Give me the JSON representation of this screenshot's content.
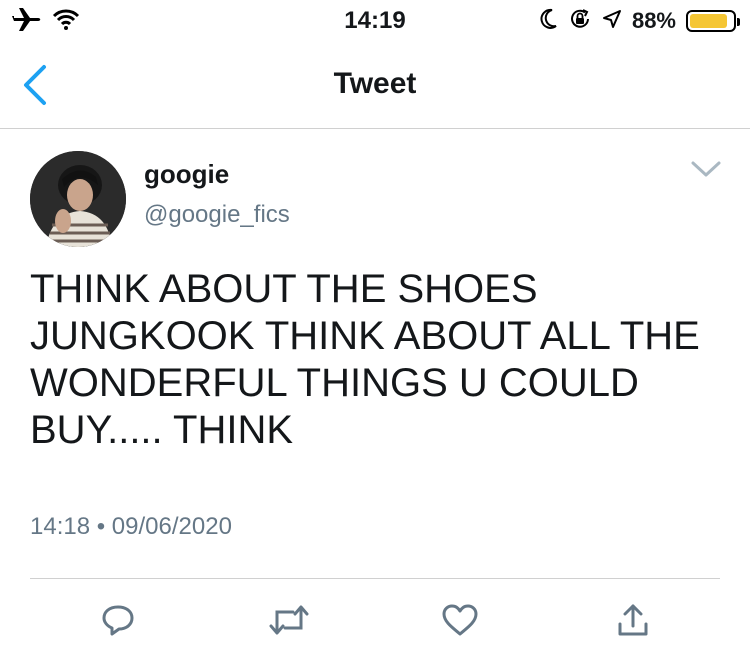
{
  "status_bar": {
    "time": "14:19",
    "battery": "88%",
    "battery_level": 0.88,
    "icons": [
      "airplane-icon",
      "wifi-icon",
      "moon-icon",
      "orientation-lock-icon",
      "location-icon",
      "battery-icon"
    ]
  },
  "nav": {
    "title": "Tweet",
    "back_icon": "chevron-left-icon"
  },
  "tweet": {
    "author_name": "googie",
    "author_handle": "@googie_fics",
    "text": "THINK ABOUT THE SHOES JUNGKOOK THINK ABOUT ALL THE WONDERFUL THINGS U COULD BUY..... THINK",
    "timestamp": "14:18 • 09/06/2020",
    "actions": [
      "reply-icon",
      "retweet-icon",
      "like-icon",
      "share-icon"
    ]
  },
  "colors": {
    "accent": "#1da1f2",
    "secondary_text": "#657786",
    "icon_gray": "#657786",
    "battery": "#f5c634"
  }
}
